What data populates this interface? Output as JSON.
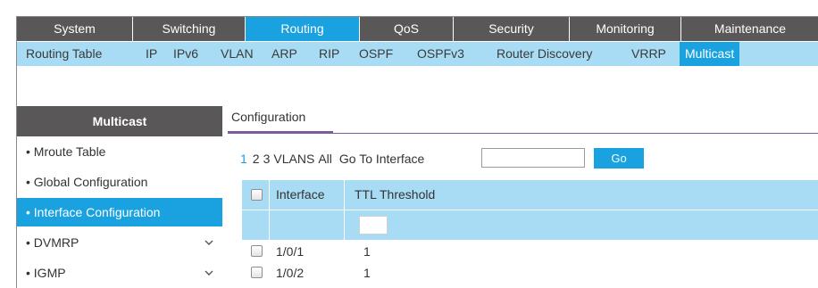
{
  "topnav": {
    "tabs": [
      {
        "label": "System",
        "active": false
      },
      {
        "label": "Switching",
        "active": false
      },
      {
        "label": "Routing",
        "active": true
      },
      {
        "label": "QoS",
        "active": false
      },
      {
        "label": "Security",
        "active": false
      },
      {
        "label": "Monitoring",
        "active": false
      },
      {
        "label": "Maintenance",
        "active": false
      }
    ]
  },
  "subnav": {
    "items": [
      {
        "label": "Routing Table"
      },
      {
        "label": "IP"
      },
      {
        "label": "IPv6"
      },
      {
        "label": "VLAN"
      },
      {
        "label": "ARP"
      },
      {
        "label": "RIP"
      },
      {
        "label": "OSPF"
      },
      {
        "label": "OSPFv3"
      },
      {
        "label": "Router Discovery"
      },
      {
        "label": "VRRP"
      },
      {
        "label": "Multicast",
        "active": true
      }
    ]
  },
  "sidebar": {
    "title": "Multicast",
    "items": [
      {
        "label": "• Mroute Table"
      },
      {
        "label": "• Global Configuration"
      },
      {
        "label": "• Interface Configuration",
        "active": true
      },
      {
        "label": "• DVMRP",
        "chevron": "chevron-down-icon"
      },
      {
        "label": "• IGMP",
        "chevron": "chevron-down-icon"
      }
    ]
  },
  "content": {
    "tab_label": "Configuration",
    "pager": {
      "pages": [
        "1",
        "2",
        "3",
        "VLANS",
        "All"
      ],
      "goto_label": "Go To Interface",
      "goto_value": "",
      "go_button": "Go"
    },
    "table": {
      "headers": {
        "interface": "Interface",
        "ttl": "TTL Threshold"
      },
      "rows": [
        {
          "interface": "1/0/1",
          "ttl": "1"
        },
        {
          "interface": "1/0/2",
          "ttl": "1"
        }
      ]
    }
  },
  "colors": {
    "accent": "#1aa1e0",
    "light_accent": "#a8dcf4",
    "dark_nav": "#595757"
  }
}
